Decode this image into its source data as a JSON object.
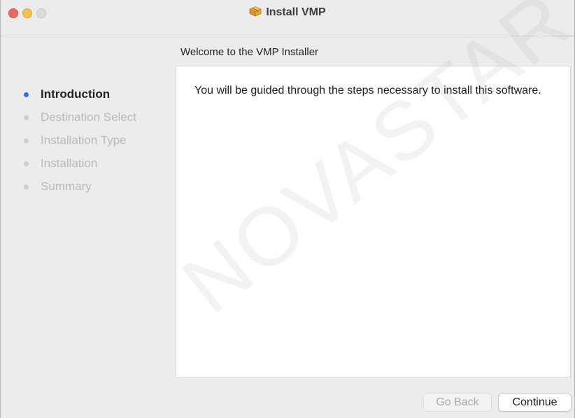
{
  "window": {
    "title": "Install VMP",
    "title_icon": "package-icon"
  },
  "heading": "Welcome to the VMP Installer",
  "steps": [
    {
      "label": "Introduction",
      "active": true
    },
    {
      "label": "Destination Select",
      "active": false
    },
    {
      "label": "Installation Type",
      "active": false
    },
    {
      "label": "Installation",
      "active": false
    },
    {
      "label": "Summary",
      "active": false
    }
  ],
  "content": {
    "message": "You will be guided through the steps necessary to install this software."
  },
  "buttons": {
    "go_back": "Go Back",
    "continue": "Continue"
  },
  "watermark": "NOVASTAR TECH",
  "colors": {
    "active_dot": "#2a6ff0",
    "inactive_dot": "#cccccc",
    "close": "#ed6a5e",
    "minimize": "#f5bf4f"
  }
}
